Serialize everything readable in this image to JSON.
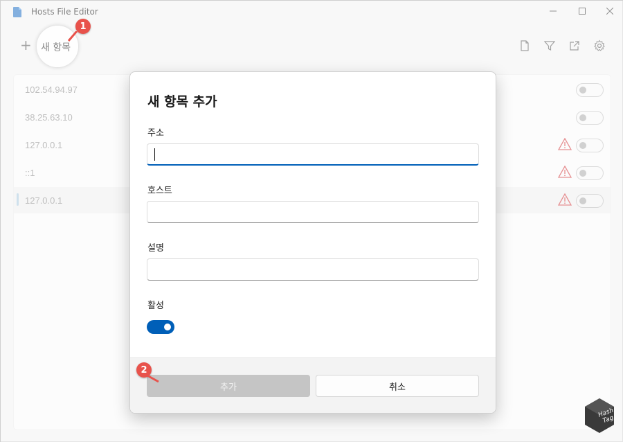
{
  "window": {
    "title": "Hosts File Editor",
    "controls": {
      "minimize": "—",
      "maximize": "☐",
      "close": "✕"
    }
  },
  "toolbar": {
    "add_label": "새 항목",
    "add_icon": "+",
    "icons": [
      "new-file-icon",
      "filter-icon",
      "open-external-icon",
      "settings-gear-icon"
    ]
  },
  "entries": [
    {
      "address": "102.54.94.97",
      "warning": false,
      "enabled": false,
      "selected": false
    },
    {
      "address": "38.25.63.10",
      "warning": false,
      "enabled": false,
      "selected": false
    },
    {
      "address": "127.0.0.1",
      "warning": true,
      "enabled": false,
      "selected": false
    },
    {
      "address": "::1",
      "warning": true,
      "enabled": false,
      "selected": false
    },
    {
      "address": "127.0.0.1",
      "warning": true,
      "enabled": false,
      "selected": true
    }
  ],
  "dialog": {
    "title": "새 항목 추가",
    "address_label": "주소",
    "address_value": "",
    "hosts_label": "호스트",
    "hosts_value": "",
    "comment_label": "설명",
    "comment_value": "",
    "active_label": "활성",
    "active_on": true,
    "add_button": "추가",
    "cancel_button": "취소"
  },
  "annotations": {
    "step1": "1",
    "step2": "2"
  },
  "watermark": {
    "line1": "Hash",
    "line2": "Tag"
  },
  "colors": {
    "accent": "#005fb8",
    "badge": "#e8524b",
    "warning": "#d13438"
  }
}
